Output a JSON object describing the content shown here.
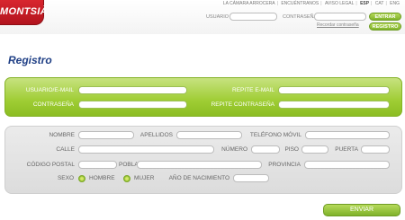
{
  "brand": {
    "logo_text": "MONTSIÀ"
  },
  "topnav": {
    "items": [
      "LA CÁMARA ARROCERA",
      "ENCUÉNTRANOS",
      "AVISO LEGAL"
    ],
    "langs": [
      "ESP",
      "CAT",
      "ENG"
    ],
    "separator": "|"
  },
  "login": {
    "user_label": "USUARIO",
    "password_label": "CONTRASEÑA",
    "enter_button": "ENTRAR",
    "register_button": "REGISTRO",
    "forgot_link": "Recordar contraseña"
  },
  "page": {
    "title": "Registro"
  },
  "account": {
    "user_email_label": "USUARIO/E-MAIL",
    "password_label": "CONTRASEÑA",
    "repeat_email_label": "REPITE E-MAIL",
    "repeat_password_label": "REPITE CONTRASEÑA"
  },
  "profile": {
    "name_label": "NOMBRE",
    "surname_label": "APELLIDOS",
    "mobile_label": "TELÉFONO MÓVIL",
    "street_label": "CALLE",
    "number_label": "NÚMERO",
    "floor_label": "PISO",
    "door_label": "PUERTA",
    "postal_label": "CÓDIGO POSTAL",
    "city_label": "POBLACIÓN",
    "province_label": "PROVINCIA",
    "sex_label": "SEXO",
    "male_label": "HOMBRE",
    "female_label": "MUJER",
    "birth_year_label": "AÑO DE NACIMIENTO"
  },
  "send_button": "ENVIAR",
  "colors": {
    "green": "#9fcd34",
    "title_blue": "#1f3f85",
    "logo_red": "#c81d26"
  }
}
